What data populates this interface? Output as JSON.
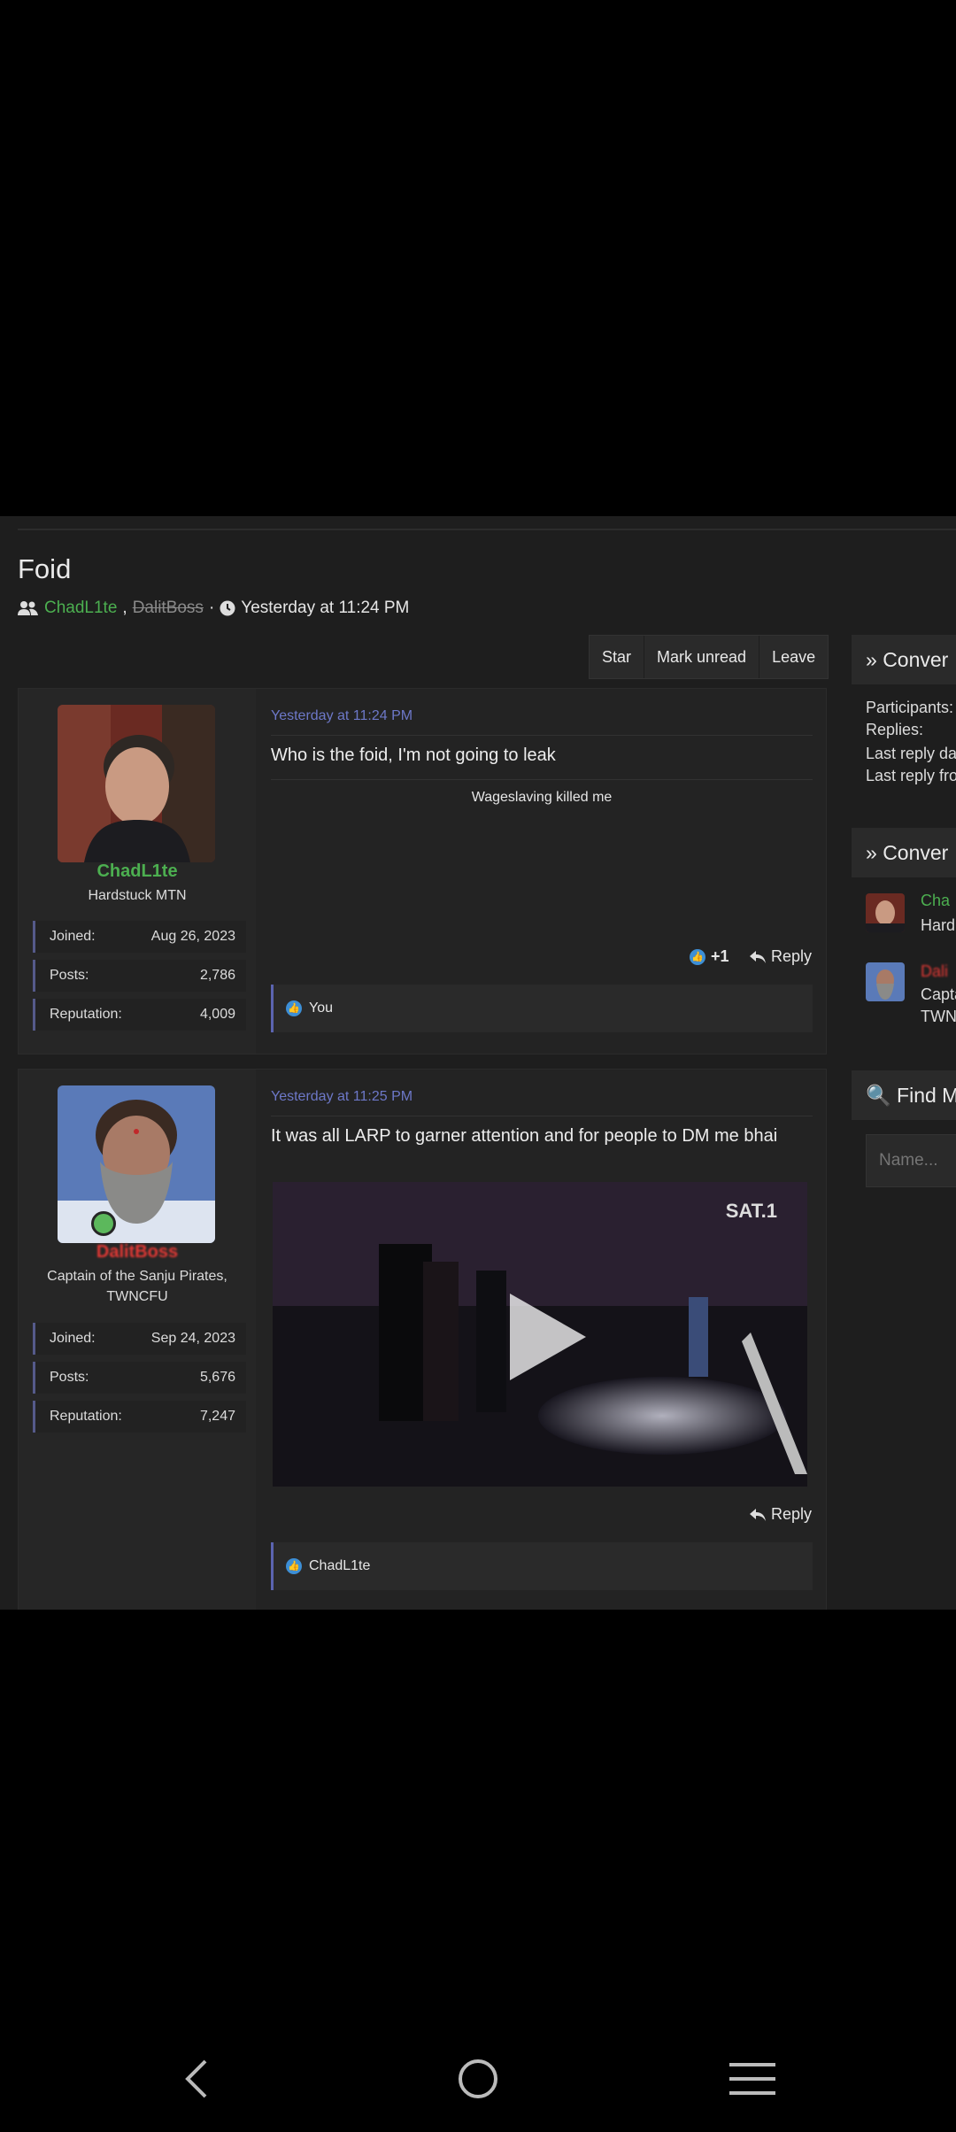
{
  "thread": {
    "title": "Foid",
    "participant_1": "ChadL1te",
    "participant_2": "DalitBoss",
    "separator": ",",
    "dot": "·",
    "started": "Yesterday at 11:24 PM"
  },
  "actions": {
    "star": "Star",
    "mark_unread": "Mark unread",
    "leave": "Leave"
  },
  "posts": [
    {
      "username": "ChadL1te",
      "user_title": "Hardstuck MTN",
      "stats": [
        {
          "label": "Joined:",
          "value": "Aug 26, 2023"
        },
        {
          "label": "Posts:",
          "value": "2,786"
        },
        {
          "label": "Reputation:",
          "value": "4,009"
        }
      ],
      "time": "Yesterday at 11:24 PM",
      "message": "Who is the foid, I'm not going to leak",
      "signature": "Wageslaving killed me",
      "reaction_count": "+1",
      "reply": "Reply",
      "liked_by": "You"
    },
    {
      "username": "DalitBoss",
      "user_title_1": "Captain of the Sanju Pirates,",
      "user_title_2": "TWNCFU",
      "stats": [
        {
          "label": "Joined:",
          "value": "Sep 24, 2023"
        },
        {
          "label": "Posts:",
          "value": "5,676"
        },
        {
          "label": "Reputation:",
          "value": "7,247"
        }
      ],
      "time": "Yesterday at 11:25 PM",
      "message": "It was all LARP to garner attention and for people to DM me bhai",
      "video_logo": "SAT.1",
      "reply": "Reply",
      "liked_by": "ChadL1te"
    }
  ],
  "sidebar": {
    "conversation_head": "Conver",
    "info": [
      "Participants:",
      "Replies:",
      "Last reply da",
      "Last reply fro"
    ],
    "participants_head": "Conver",
    "p1_name": "Cha",
    "p1_title": "Hard",
    "p2_name": "Dali",
    "p2_title_1": "Capta",
    "p2_title_2": "TWN",
    "find_head": "Find M",
    "name_placeholder": "Name..."
  },
  "colors": {
    "accent": "#6d78c8",
    "green_user": "#4caf50",
    "red_user": "#e53935"
  }
}
